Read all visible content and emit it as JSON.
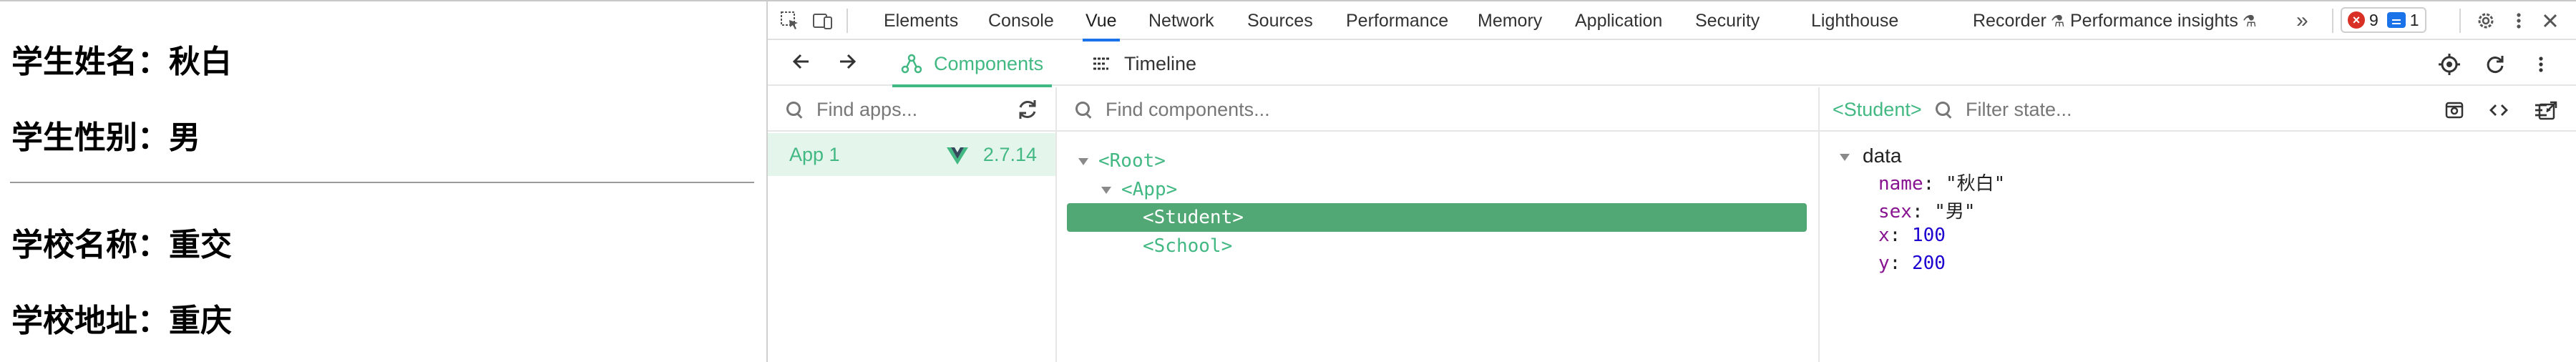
{
  "page": {
    "lines": [
      "学生姓名：秋白",
      "学生性别：男",
      "学校名称：重交",
      "学校地址：重庆"
    ]
  },
  "devtools": {
    "tabs": [
      "Elements",
      "Console",
      "Vue",
      "Network",
      "Sources",
      "Performance",
      "Memory",
      "Application",
      "Security",
      "Lighthouse",
      "Recorder",
      "Performance insights"
    ],
    "active_tab": "Vue",
    "more_tabs": "»",
    "errors_count": "9",
    "messages_count": "1",
    "colors": {
      "accent": "#1a73e8",
      "vue_green": "#42b883",
      "error": "#d93025"
    }
  },
  "vue": {
    "tabs": [
      "Components",
      "Timeline"
    ],
    "active_tab": "Components",
    "apps_search_placeholder": "Find apps...",
    "components_search_placeholder": "Find components...",
    "state_search_placeholder": "Filter state...",
    "app": {
      "name": "App 1",
      "version": "2.7.14"
    },
    "tree": [
      "<Root>",
      "<App>",
      "<Student>",
      "<School>"
    ],
    "selected_component": "<Student>",
    "state": {
      "section": "data",
      "items": [
        {
          "key": "name",
          "value": "\"秋白\""
        },
        {
          "key": "sex",
          "value": "\"男\""
        },
        {
          "key": "x",
          "value": "100"
        },
        {
          "key": "y",
          "value": "200"
        }
      ]
    }
  }
}
